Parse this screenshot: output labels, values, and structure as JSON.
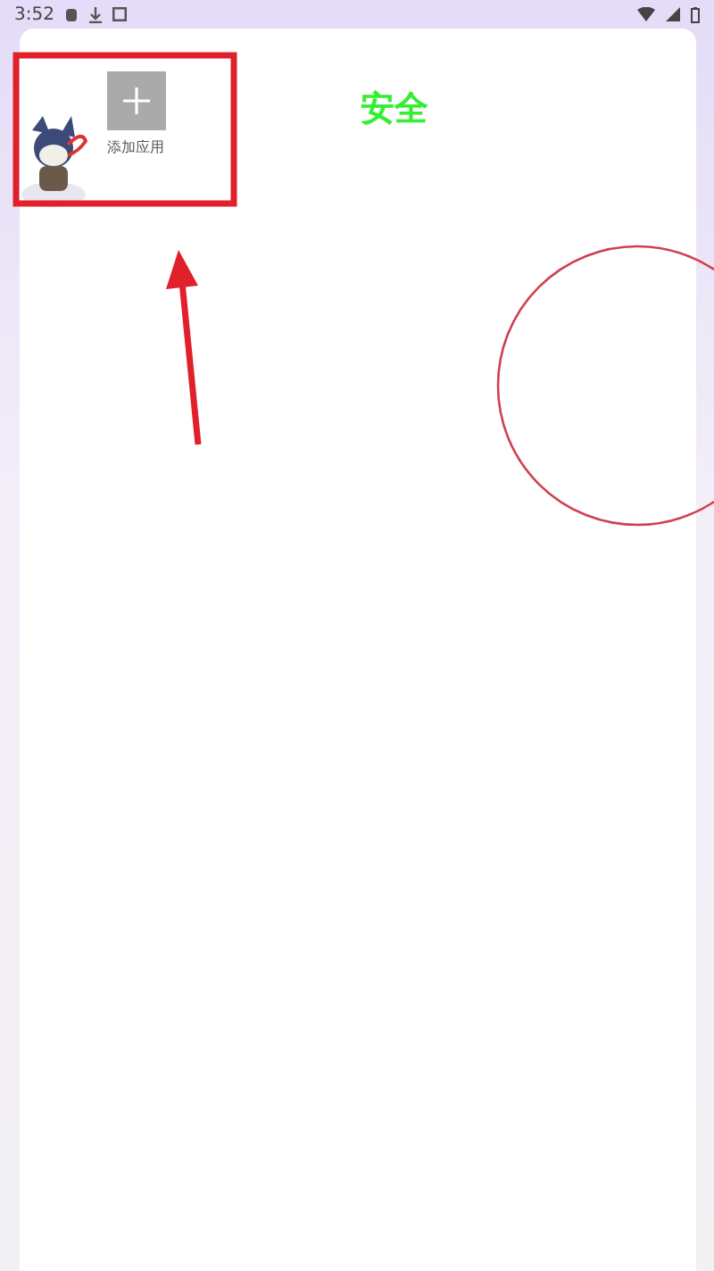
{
  "status_bar": {
    "time": "3:52"
  },
  "add_app": {
    "label": "添加应用"
  },
  "title": "安全"
}
